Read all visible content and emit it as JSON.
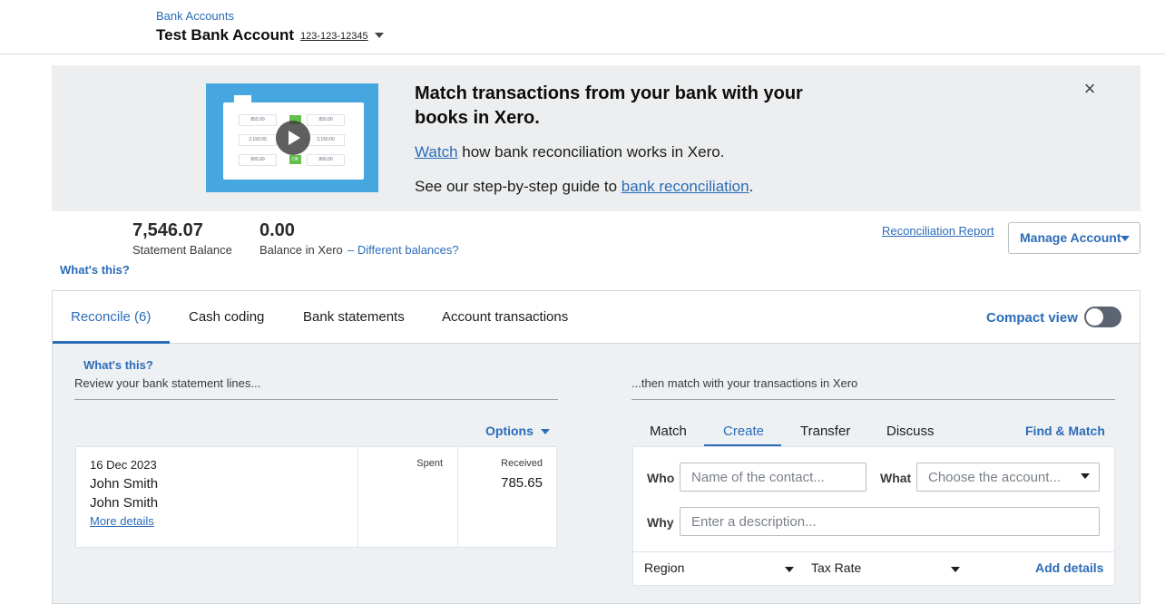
{
  "header": {
    "breadcrumb": "Bank Accounts",
    "account_name": "Test Bank Account",
    "account_number": "123-123-12345"
  },
  "banner": {
    "title": "Match transactions from your bank with your books in Xero.",
    "watch_link": "Watch",
    "watch_rest": " how bank reconciliation works in Xero.",
    "guide_prefix": "See our step-by-step guide to ",
    "guide_link": "bank reconciliation",
    "guide_suffix": ".",
    "video_cells": [
      "850.00",
      "850.00",
      "2,150.00",
      "2,150.00",
      "800.00",
      "800.00"
    ],
    "video_ok": "OK",
    "close_icon": "close-icon"
  },
  "balances": {
    "statement_value": "7,546.07",
    "statement_label": "Statement Balance",
    "xero_value": "0.00",
    "xero_label": "Balance in Xero",
    "different_link": "– Different balances?",
    "whats_this": "What's this?",
    "reconciliation_report": "Reconciliation Report",
    "manage_account": "Manage Account"
  },
  "tabs": {
    "items": [
      {
        "label": "Reconcile (6)",
        "active": true
      },
      {
        "label": "Cash coding"
      },
      {
        "label": "Bank statements"
      },
      {
        "label": "Account transactions"
      }
    ],
    "compact_view": "Compact view",
    "compact_on": false
  },
  "reconcile": {
    "whats_this": "What's this?",
    "left_heading": "Review your bank statement lines...",
    "right_heading": "...then match with your transactions in Xero",
    "options": "Options",
    "statement_line": {
      "date": "16 Dec 2023",
      "payee": "John Smith",
      "reference": "John Smith",
      "more_details": "More details",
      "spent_label": "Spent",
      "received_label": "Received",
      "received_value": "785.65"
    },
    "match_tabs": [
      "Match",
      "Create",
      "Transfer",
      "Discuss"
    ],
    "active_match_tab": "Create",
    "find_match": "Find & Match",
    "form": {
      "who_label": "Who",
      "who_placeholder": "Name of the contact...",
      "what_label": "What",
      "what_placeholder": "Choose the account...",
      "why_label": "Why",
      "why_placeholder": "Enter a description...",
      "region": "Region",
      "tax_rate": "Tax Rate",
      "add_details": "Add details"
    }
  },
  "colors": {
    "accent": "#2b6cb8",
    "banner_bg": "#eceef0",
    "video_bg": "#46a7e0",
    "ok_green": "#62c04b",
    "panel_bg": "#eef1f4"
  }
}
